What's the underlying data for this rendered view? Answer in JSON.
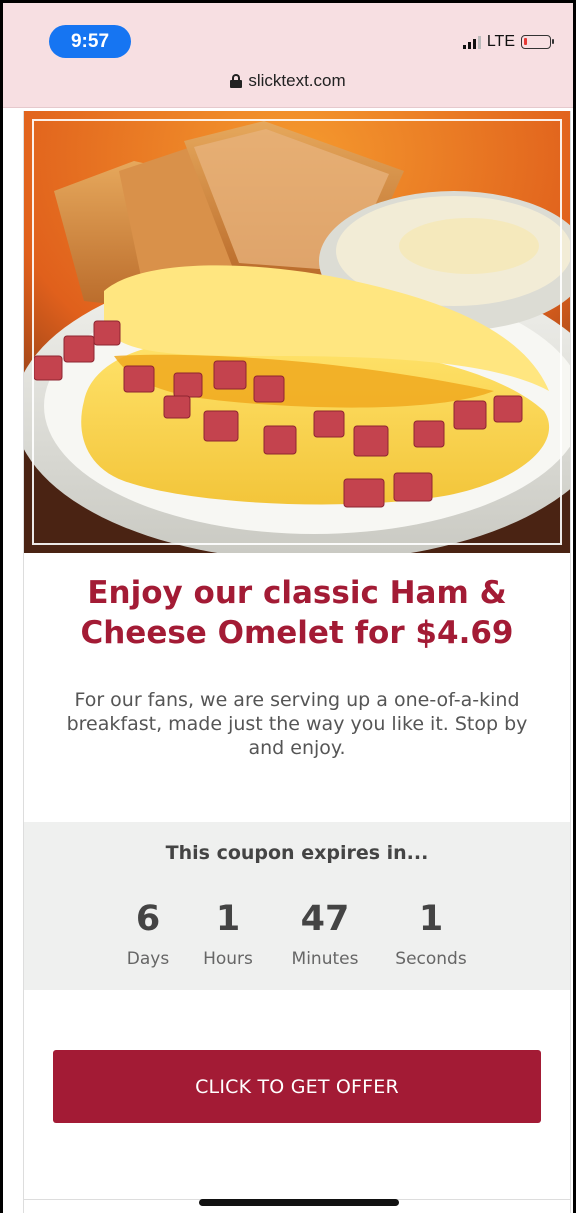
{
  "status_bar": {
    "time": "9:57",
    "network": "LTE",
    "url": "slicktext.com",
    "battery_level": 0.15
  },
  "icons": {
    "lock": "lock-icon",
    "signal": "signal-icon",
    "battery": "battery-icon"
  },
  "offer": {
    "headline": "Enjoy our classic Ham & Cheese Omelet for $4.69",
    "description": "For our fans, we are serving up a one-of-a-kind breakfast, made just the way you like it. Stop by and enjoy."
  },
  "countdown": {
    "title": "This coupon expires in...",
    "units": [
      {
        "value": "6",
        "label": "Days"
      },
      {
        "value": "1",
        "label": "Hours"
      },
      {
        "value": "47",
        "label": "Minutes"
      },
      {
        "value": "1",
        "label": "Seconds"
      }
    ]
  },
  "cta": {
    "label": "CLICK TO GET OFFER"
  },
  "colors": {
    "brand": "#a31b35",
    "status_bg": "#f7dfe2",
    "time_pill": "#1675f2",
    "countdown_bg": "#eff0ef"
  }
}
